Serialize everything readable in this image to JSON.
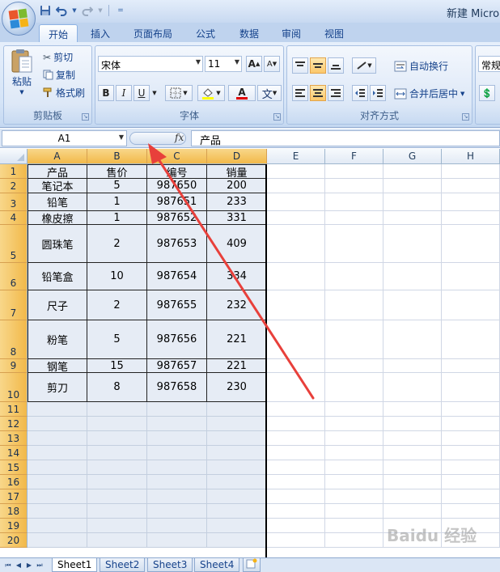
{
  "window": {
    "title": "新建 Micro"
  },
  "tabs": [
    "开始",
    "插入",
    "页面布局",
    "公式",
    "数据",
    "审阅",
    "视图"
  ],
  "clipboard": {
    "paste": "粘贴",
    "cut": "剪切",
    "copy": "复制",
    "format_painter": "格式刷",
    "label": "剪贴板"
  },
  "font": {
    "name": "宋体",
    "size": "11",
    "grow": "A",
    "shrink": "A",
    "bold": "B",
    "italic": "I",
    "underline": "U",
    "font_color": "A",
    "phonetic": "文",
    "label": "字体"
  },
  "alignment": {
    "wrap_text": "自动换行",
    "merge_center": "合并后居中",
    "label": "对齐方式"
  },
  "number": {
    "format": "常规"
  },
  "formula_bar": {
    "name_box": "A1",
    "fx": "fx",
    "content": "产品"
  },
  "columns": [
    "A",
    "B",
    "C",
    "D",
    "E",
    "F",
    "G",
    "H"
  ],
  "rows": [
    "1",
    "2",
    "3",
    "4",
    "5",
    "6",
    "7",
    "8",
    "9",
    "10",
    "11",
    "12",
    "13",
    "14",
    "15",
    "16",
    "17",
    "18",
    "19",
    "20"
  ],
  "table": {
    "headers": [
      "产品",
      "售价",
      "编号",
      "销量"
    ],
    "rows": [
      [
        "笔记本",
        "5",
        "987650",
        "200"
      ],
      [
        "铅笔",
        "1",
        "987651",
        "233"
      ],
      [
        "橡皮擦",
        "1",
        "987652",
        "331"
      ],
      [
        "圆珠笔",
        "2",
        "987653",
        "409"
      ],
      [
        "铅笔盒",
        "10",
        "987654",
        "334"
      ],
      [
        "尺子",
        "2",
        "987655",
        "232"
      ],
      [
        "粉笔",
        "5",
        "987656",
        "221"
      ],
      [
        "钢笔",
        "15",
        "987657",
        "221"
      ],
      [
        "剪刀",
        "8",
        "987658",
        "230"
      ]
    ]
  },
  "sheets": [
    "Sheet1",
    "Sheet2",
    "Sheet3",
    "Sheet4"
  ],
  "watermark": "Baidu 经验",
  "colors": {
    "annotation_arrow": "#e8403b",
    "selection_header": "#f2b94a",
    "ribbon": "#d5e4f7"
  }
}
